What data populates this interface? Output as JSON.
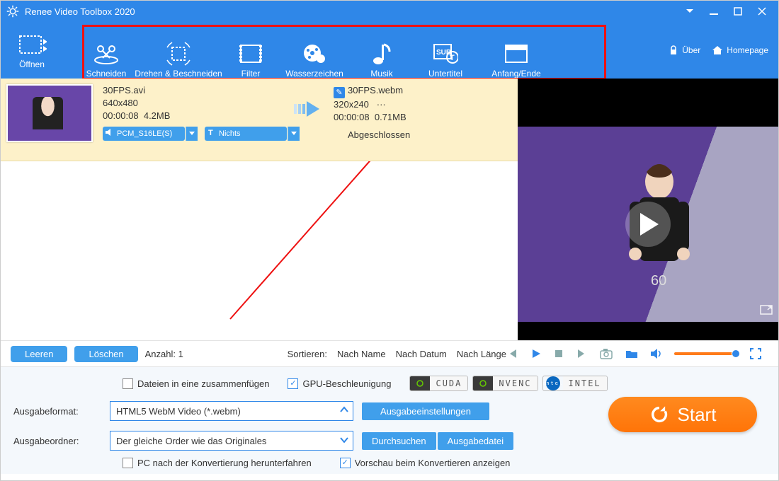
{
  "title": "Renee Video Toolbox 2020",
  "toolbar": {
    "open": "Öffnen",
    "cut": "Schneiden",
    "rotate": "Drehen & Beschneiden",
    "filter": "Filter",
    "watermark": "Wasserzeichen",
    "music": "Musik",
    "subtitle": "Untertitel",
    "startend": "Anfang/Ende",
    "about": "Über",
    "homepage": "Homepage"
  },
  "file": {
    "src": {
      "name": "30FPS.avi",
      "res": "640x480",
      "dur": "00:00:08",
      "size": "4.2MB"
    },
    "dst": {
      "name": "30FPS.webm",
      "res": "320x240",
      "more": "···",
      "dur": "00:00:08",
      "size": "0.71MB"
    },
    "audio": "PCM_S16LE(S)",
    "subtitle": "Nichts",
    "status": "Abgeschlossen"
  },
  "mid": {
    "clear": "Leeren",
    "delete": "Löschen",
    "count_label": "Anzahl:",
    "count_value": "1",
    "sort_label": "Sortieren:",
    "sort_name": "Nach Name",
    "sort_date": "Nach Datum",
    "sort_len": "Nach Länge"
  },
  "preview_badge": "60",
  "options": {
    "merge": "Dateien in eine zusammenfügen",
    "gpu": "GPU-Beschleunigung",
    "cuda": "CUDA",
    "nvenc": "NVENC",
    "intel": "INTEL",
    "outfmt_label": "Ausgabeformat:",
    "outfmt_value": "HTML5 WebM Video (*.webm)",
    "outset": "Ausgabeeinstellungen",
    "outdir_label": "Ausgabeordner:",
    "outdir_value": "Der gleiche Order wie das Originales",
    "browse": "Durchsuchen",
    "outfile": "Ausgabedatei",
    "shutdown": "PC nach der Konvertierung herunterfahren",
    "preview_on_convert": "Vorschau beim Konvertieren anzeigen",
    "start": "Start"
  }
}
